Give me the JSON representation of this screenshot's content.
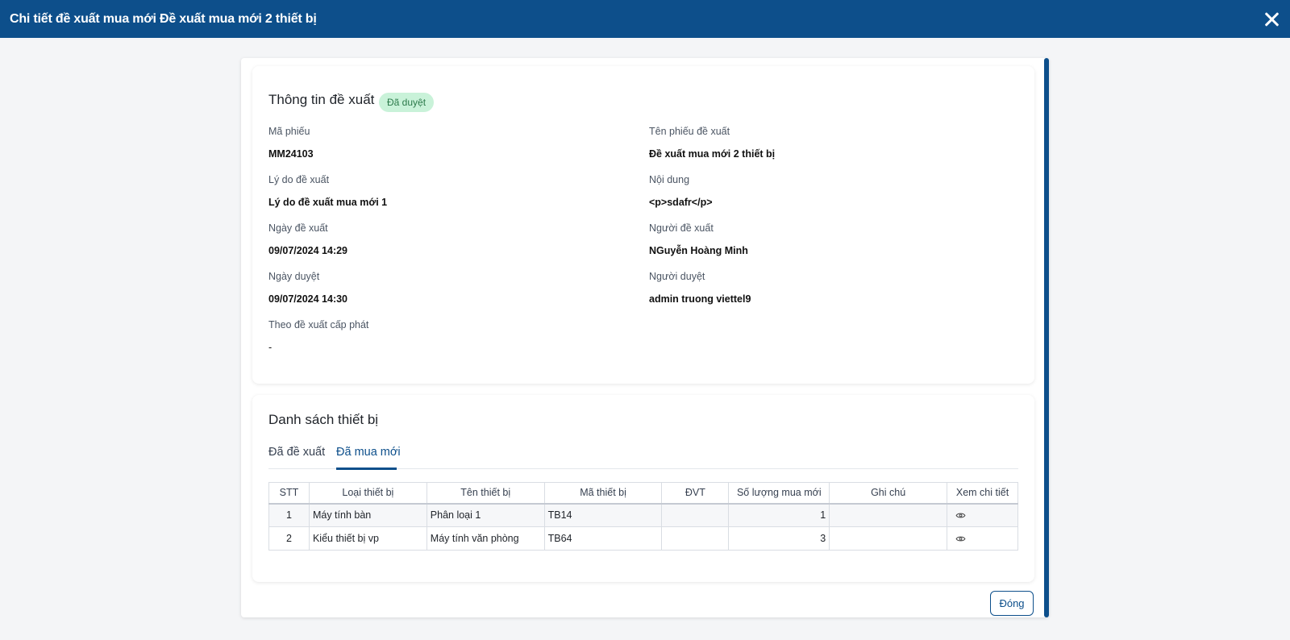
{
  "window": {
    "title": "Chi tiết đề xuất mua mới Đề xuất mua mới 2 thiết bị"
  },
  "info": {
    "title": "Thông tin đề xuất",
    "status_badge": "Đã duyệt",
    "fields": {
      "ma_phieu": {
        "label": "Mã phiếu",
        "value": "MM24103"
      },
      "ten_phieu": {
        "label": "Tên phiếu đề xuất",
        "value": "Đề xuất mua mới 2 thiết bị"
      },
      "ly_do": {
        "label": "Lý do đề xuất",
        "value": "Lý do đề xuất mua mới 1"
      },
      "noi_dung": {
        "label": "Nội dung",
        "value": "<p>sdafr</p>"
      },
      "ngay_de_xuat": {
        "label": "Ngày đề xuất",
        "value": "09/07/2024 14:29"
      },
      "nguoi_de_xuat": {
        "label": "Người đề xuất",
        "value": "NGuyễn Hoàng Minh"
      },
      "ngay_duyet": {
        "label": "Ngày duyệt",
        "value": "09/07/2024 14:30"
      },
      "nguoi_duyet": {
        "label": "Người duyệt",
        "value": "admin truong viettel9"
      },
      "theo_de_xuat": {
        "label": "Theo đề xuất cấp phát",
        "value": "-"
      }
    }
  },
  "devices": {
    "title": "Danh sách thiết bị",
    "tabs": [
      {
        "label": "Đã đề xuất",
        "active": false
      },
      {
        "label": "Đã mua mới",
        "active": true
      }
    ],
    "columns": [
      "STT",
      "Loại thiết bị",
      "Tên thiết bị",
      "Mã thiết bị",
      "ĐVT",
      "Số lượng mua mới",
      "Ghi chú",
      "Xem chi tiết"
    ],
    "rows": [
      {
        "stt": "1",
        "loai": "Máy tính bàn",
        "ten": "Phân loại 1",
        "ma": "TB14",
        "dvt": "",
        "so_luong": "1",
        "ghi_chu": "",
        "icon": "eye-icon"
      },
      {
        "stt": "2",
        "loai": "Kiểu thiết bị vp",
        "ten": "Máy tính văn phòng",
        "ma": "TB64",
        "dvt": "",
        "so_luong": "3",
        "ghi_chu": "",
        "icon": "eye-icon"
      }
    ]
  },
  "footer": {
    "close_label": "Đóng"
  },
  "colors": {
    "primary": "#0d4f8b",
    "badge_bg": "#c9f2d9",
    "badge_text": "#2c7a4b"
  }
}
